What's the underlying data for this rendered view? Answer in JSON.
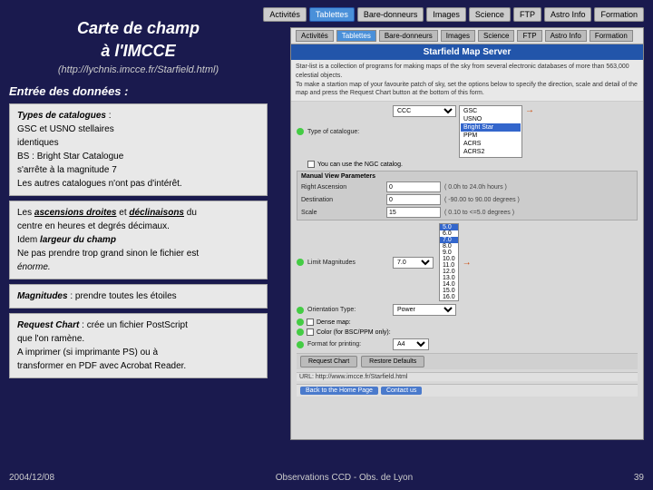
{
  "slide": {
    "title_line1": "Carte de champ",
    "title_line2": "à l'IMCCE",
    "subtitle": "(http://lychnis.imcce.fr/Starfield.html)",
    "section_entree": "Entrée des données :",
    "box1_content": [
      {
        "type": "bold-italic",
        "text": "Types de catalogues"
      },
      {
        "type": "normal",
        "text": " :"
      },
      {
        "type": "normal",
        "text": "GSC et USNO stellaires"
      },
      {
        "type": "normal",
        "text": "identiques"
      },
      {
        "type": "normal",
        "text": "BS : Bright Star Catalogue"
      },
      {
        "type": "normal",
        "text": "s'arrête à la magnitude 7"
      },
      {
        "type": "normal",
        "text": "Les autres catalogues n'ont pas d'intérêt."
      }
    ],
    "box2_content": [
      {
        "type": "bold-italic",
        "text": "Les ascensions droites"
      },
      {
        "type": "normal",
        "text": " et "
      },
      {
        "type": "bold-italic",
        "text": "déclinaisons"
      },
      {
        "type": "normal",
        "text": " du"
      },
      {
        "type": "normal",
        "text": "centre en heures et degrés décimaux."
      },
      {
        "type": "normal",
        "text": "Idem "
      },
      {
        "type": "bold-italic",
        "text": "largeur du champ"
      },
      {
        "type": "normal",
        "text": "Ne pas prendre trop grand sinon le fichier est"
      },
      {
        "type": "italic",
        "text": "énorme."
      }
    ],
    "box3_content": [
      {
        "type": "bold-italic",
        "text": "Magnitudes"
      },
      {
        "type": "normal",
        "text": " : prendre toutes les étoiles"
      }
    ],
    "box4_content": [
      {
        "type": "bold-italic",
        "text": "Request Chart"
      },
      {
        "type": "normal",
        "text": " : crée un fichier PostScript"
      },
      {
        "type": "normal",
        "text": "que l'on ramène."
      },
      {
        "type": "normal",
        "text": " A imprimer (si imprimante PS) ou à"
      },
      {
        "type": "normal",
        "text": "transformer en PDF avec Acrobat Reader."
      }
    ],
    "footer_date": "2004/12/08",
    "footer_center": "Observations CCD - Obs. de Lyon",
    "footer_page": "39"
  },
  "nav": {
    "tabs": [
      "Activités",
      "Tablettes",
      "Bare-donneurs",
      "Images",
      "Science",
      "FTP",
      "Astro Info",
      "Formation"
    ]
  },
  "screenshot": {
    "title": "Starfield Map Server",
    "description": "Star-list is a collection of programs for making maps of the sky from several electronic databases of more than 563,000 celestial objects.",
    "desc2": "To make a startion map of your favourite patch of sky, set the options below to specify the direction, scale and detail of the map and press the Request Chart button at the bottom of this form.",
    "type_label": "Type of catalogue:",
    "catalogue_options": [
      "GSC",
      "USNO",
      "Bright Star",
      "PPM",
      "ACRS",
      "ACRS2"
    ],
    "selected_catalogue": "Bright Star",
    "ngc_checkbox_label": "You can use the NGC catalog.",
    "manual_view_label": "Manual View Parameters",
    "ra_label": "Right Ascension",
    "ra_value": "0",
    "ra_range": "( 0.0h to 24.0h hours )",
    "dec_label": "Destination",
    "dec_value": "0",
    "dec_range": "( -90.00 to 90.00 degrees )",
    "scale_label": "Scale",
    "scale_value": "15",
    "scale_range": "( 0.10 to <=5.0 degrees )",
    "limit_mag_label": "Limit Magnitudes",
    "limit_mag_value": "7.0",
    "magnitude_options": [
      "5.0",
      "6.0",
      "7.0",
      "8.0",
      "9.0",
      "10.0",
      "11.0",
      "12.0",
      "13.0",
      "14.0",
      "15.0",
      "16.0"
    ],
    "selected_magnitude": "7.0",
    "orientation_label": "Orientation Type:",
    "orientation_value": "Power",
    "dense_checkbox_label": "Dense map:",
    "color_checkbox_label": "Color (for BSC/PPM only):",
    "format_label": "Format for printing:",
    "format_value": "A4",
    "request_chart_btn": "Request Chart",
    "restore_defaults_btn": "Restore Defaults",
    "url_label": "URL: http://www.imcce.fr/Starfield.html",
    "back_home_btn": "Back to the Home Page",
    "contact_btn": "Contact us"
  }
}
